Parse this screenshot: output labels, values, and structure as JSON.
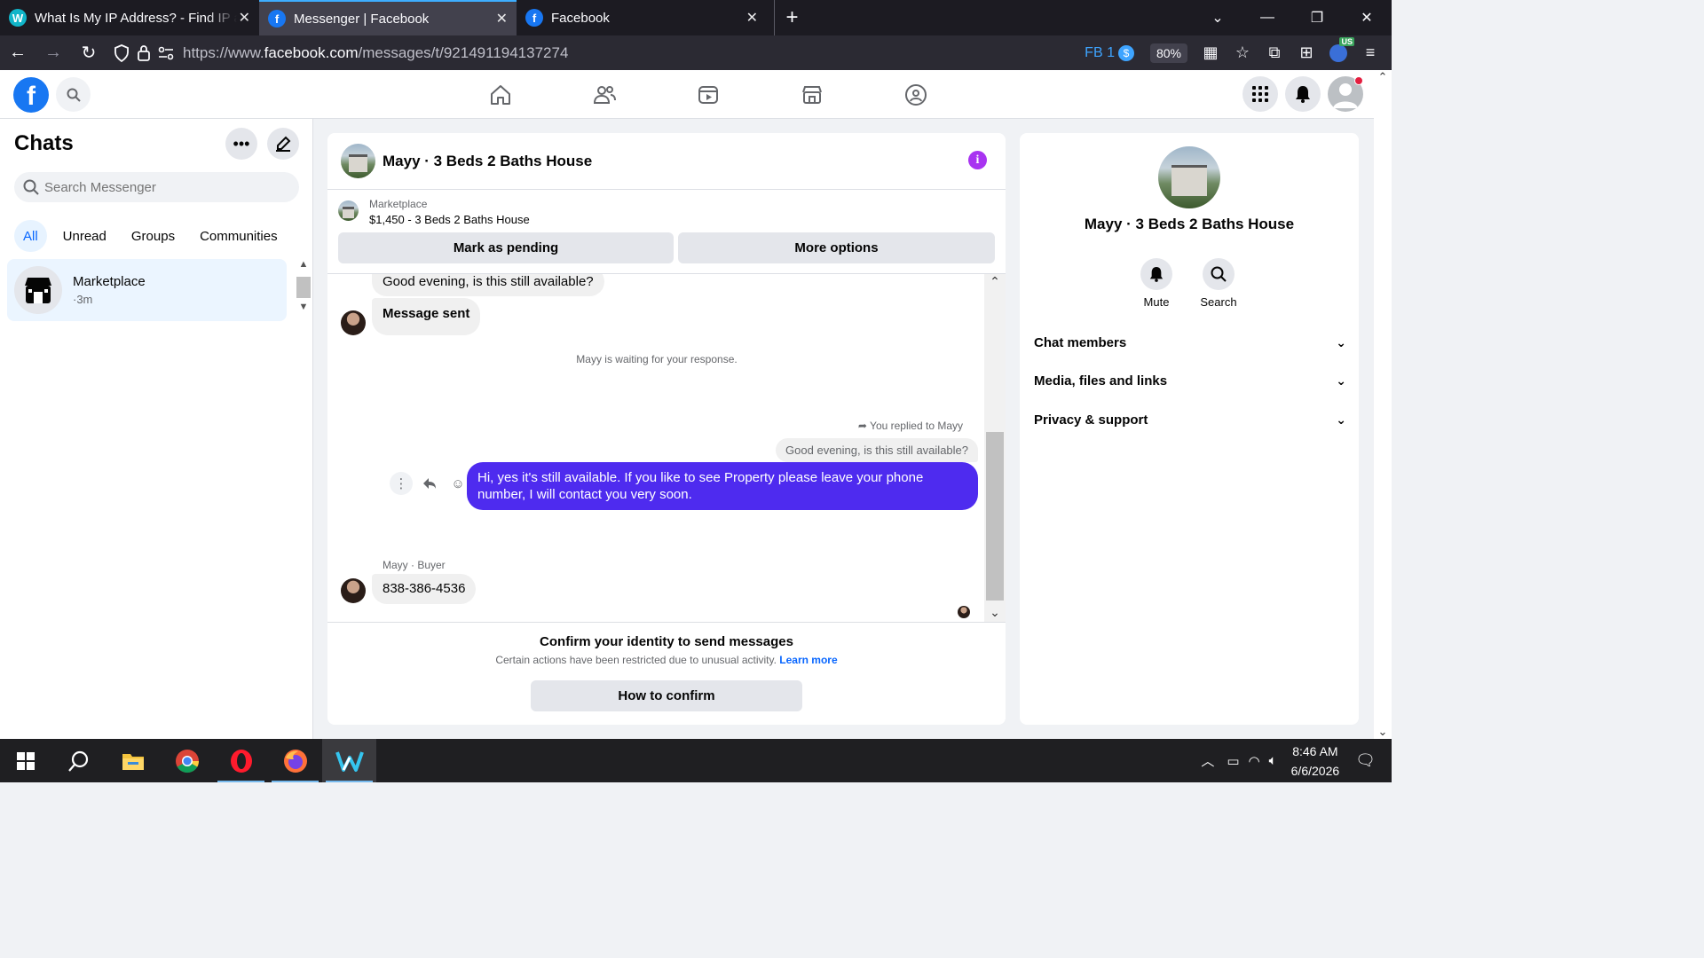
{
  "browser": {
    "tabs": [
      {
        "title": "What Is My IP Address? - Find IP a",
        "favicon": "w-icon"
      },
      {
        "title": "Messenger | Facebook",
        "favicon": "facebook-icon",
        "active": true
      },
      {
        "title": "Facebook",
        "favicon": "facebook-icon"
      }
    ],
    "url_prefix": "https://www.",
    "url_host": "facebook.com",
    "url_path": "/messages/t/921491194137274",
    "fb_badge": "FB 1",
    "zoom": "80%",
    "vpn_badge": "US"
  },
  "sidebar": {
    "title": "Chats",
    "search_placeholder": "Search Messenger",
    "filters": [
      "All",
      "Unread",
      "Groups",
      "Communities"
    ],
    "active_filter": "All",
    "chats": [
      {
        "name": "Marketplace",
        "time": "·3m"
      }
    ]
  },
  "conversation": {
    "title": "Mayy · 3 Beds 2 Baths House",
    "marketplace_label": "Marketplace",
    "listing": "$1,450 - 3 Beds 2 Baths House",
    "mark_pending": "Mark as pending",
    "more_options": "More options",
    "messages": {
      "first_in": "Good evening, is this still available?",
      "sent_notice": "Message sent",
      "waiting_note": "Mayy is waiting for your response.",
      "replied_label": "You replied to Mayy",
      "quoted": "Good evening, is this still available?",
      "reply": "Hi, yes it's still available. If you like to see Property please leave your phone number, I will contact you very soon.",
      "sender_label": "Mayy · Buyer",
      "phone": "838-386-4536"
    },
    "confirm": {
      "title": "Confirm your identity to send messages",
      "subtitle": "Certain actions have been restricted due to unusual activity.",
      "learn_more": "Learn more",
      "button": "How to confirm"
    }
  },
  "info_panel": {
    "name": "Mayy · 3 Beds 2 Baths House",
    "mute": "Mute",
    "search": "Search",
    "sections": [
      "Chat members",
      "Media, files and links",
      "Privacy & support"
    ]
  },
  "taskbar": {
    "time": "8:46 AM",
    "date": "6/6/2026"
  },
  "colors": {
    "fb_blue": "#1877f2",
    "outgoing_bubble": "#4e2bef",
    "info_purple": "#a833f1",
    "active_filter_bg": "#e7f3ff"
  }
}
